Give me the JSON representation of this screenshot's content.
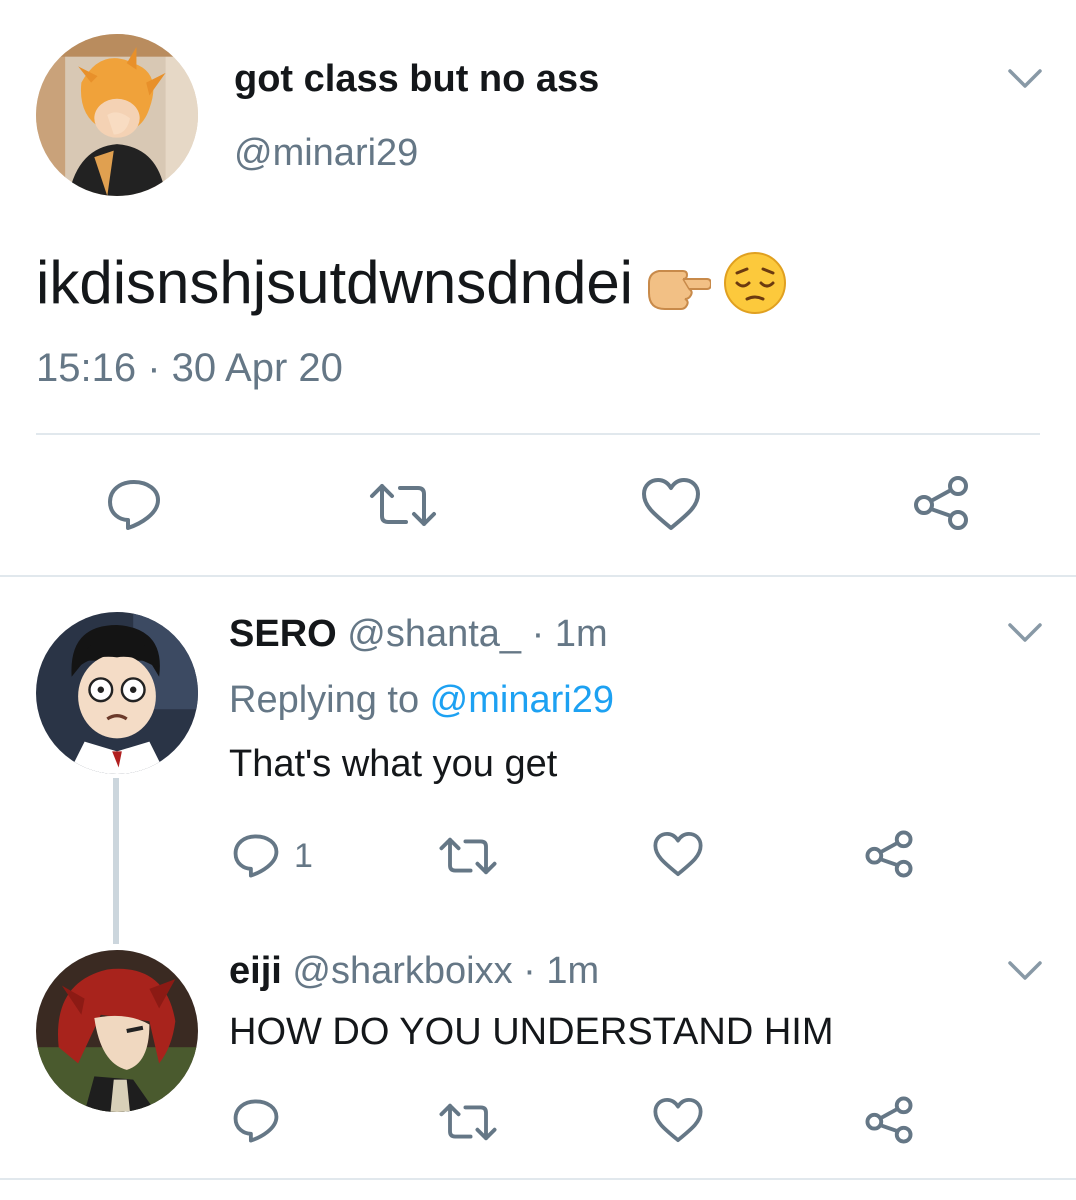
{
  "main_tweet": {
    "display_name": "got class but no ass",
    "handle": "@minari29",
    "text": "ikdisnshjsutdwnsdndei",
    "emojis": [
      "backhand-index-pointing-left",
      "pensive-face"
    ],
    "timestamp": "15:16 · 30 Apr 20"
  },
  "replies": [
    {
      "display_name": "SERO",
      "handle": "@shanta_",
      "time": " · 1m",
      "replying_prefix": "Replying to ",
      "replying_to": "@minari29",
      "text": "That's what you get",
      "reply_count": "1"
    },
    {
      "display_name": "eiji",
      "handle": "@sharkboixx",
      "time": " · 1m",
      "text": "HOW DO YOU UNDERSTAND HIM",
      "reply_count": ""
    }
  ],
  "colors": {
    "text": "#14171a",
    "secondary": "#657786",
    "link": "#1da1f2",
    "divider": "#e1e8ed",
    "thread_line": "#ccd6dd"
  }
}
